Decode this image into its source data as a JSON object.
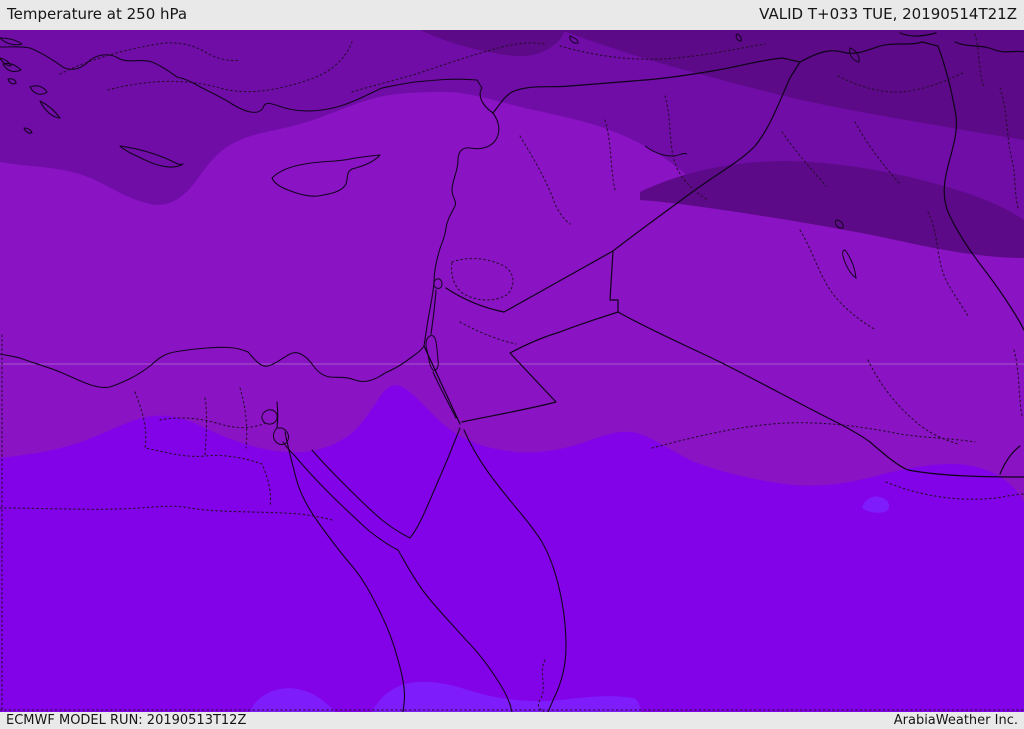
{
  "header": {
    "title": "Temperature at 250 hPa",
    "valid_label": "VALID T+033 TUE, 20190514T21Z",
    "parameter": "Temperature",
    "level": "250 hPa",
    "lead_time": "T+033",
    "valid_weekday": "TUE",
    "valid_time": "20190514T21Z"
  },
  "footer": {
    "model_run_label": "ECMWF MODEL RUN: 20190513T12Z",
    "model": "ECMWF",
    "run_time": "20190513T12Z",
    "credit": "ArabiaWeather Inc."
  },
  "map": {
    "region": "Eastern Mediterranean / Middle East",
    "type": "temperature shading with coastlines, country borders and administrative dotted boundaries",
    "colors": {
      "band_coldest": "#5c0a87",
      "band_cold": "#6f0da6",
      "band_mid": "#8a13c4",
      "band_warm": "#8203e8",
      "band_warmest": "#7f1cfc",
      "bar_bg": "#e9e9e9",
      "bar_text": "#161616",
      "line": "#140320",
      "gridline": "#bd93d8"
    },
    "bands": [
      {
        "name": "coldest",
        "placement": "top-right patches (E Turkey / N Iraq)"
      },
      {
        "name": "cold",
        "placement": "upper band across Turkey / N Syria / N Iraq"
      },
      {
        "name": "mid",
        "placement": "central band: Mediterranean, Levant, central Iraq"
      },
      {
        "name": "warm",
        "placement": "lower band: Egypt, N Saudi Arabia"
      },
      {
        "name": "warmest",
        "placement": "small patches along bottom edge"
      }
    ]
  }
}
